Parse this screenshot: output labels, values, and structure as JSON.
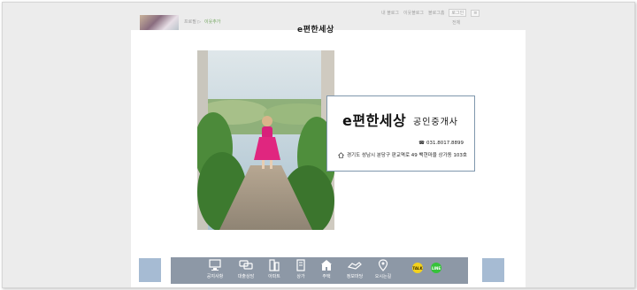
{
  "blog": {
    "nickname": "프로필 ▷",
    "neighbor_button": "이웃추가",
    "top_links": [
      "내 블로그",
      "이웃블로그",
      "블로그홈",
      "로그인"
    ],
    "menu_link": "전체"
  },
  "page": {
    "title_top": "e편한세상"
  },
  "card": {
    "brand": "e편한세상",
    "subtitle": "공인중개사",
    "phone": "031.8017.8899",
    "address": "경기도 성남시 분당구 판교역로 49 백현마을 상가동 103호"
  },
  "nav": {
    "items": [
      {
        "label": "공지사항",
        "icon": "monitor-icon"
      },
      {
        "label": "대출상담",
        "icon": "chat-icon"
      },
      {
        "label": "아파트",
        "icon": "apartment-icon"
      },
      {
        "label": "상가",
        "icon": "store-building-icon"
      },
      {
        "label": "주택",
        "icon": "house-icon"
      },
      {
        "label": "정보마당",
        "icon": "handshake-icon"
      },
      {
        "label": "오시는길",
        "icon": "location-pin-icon"
      }
    ],
    "talk_label": "TALK",
    "line_label": "LINE"
  },
  "colors": {
    "navbar": "#8d98a6",
    "side_blocks": "#a6bbd3",
    "card_border": "#7f97ad",
    "kakao": "#f4d21c",
    "line": "#35c239"
  }
}
